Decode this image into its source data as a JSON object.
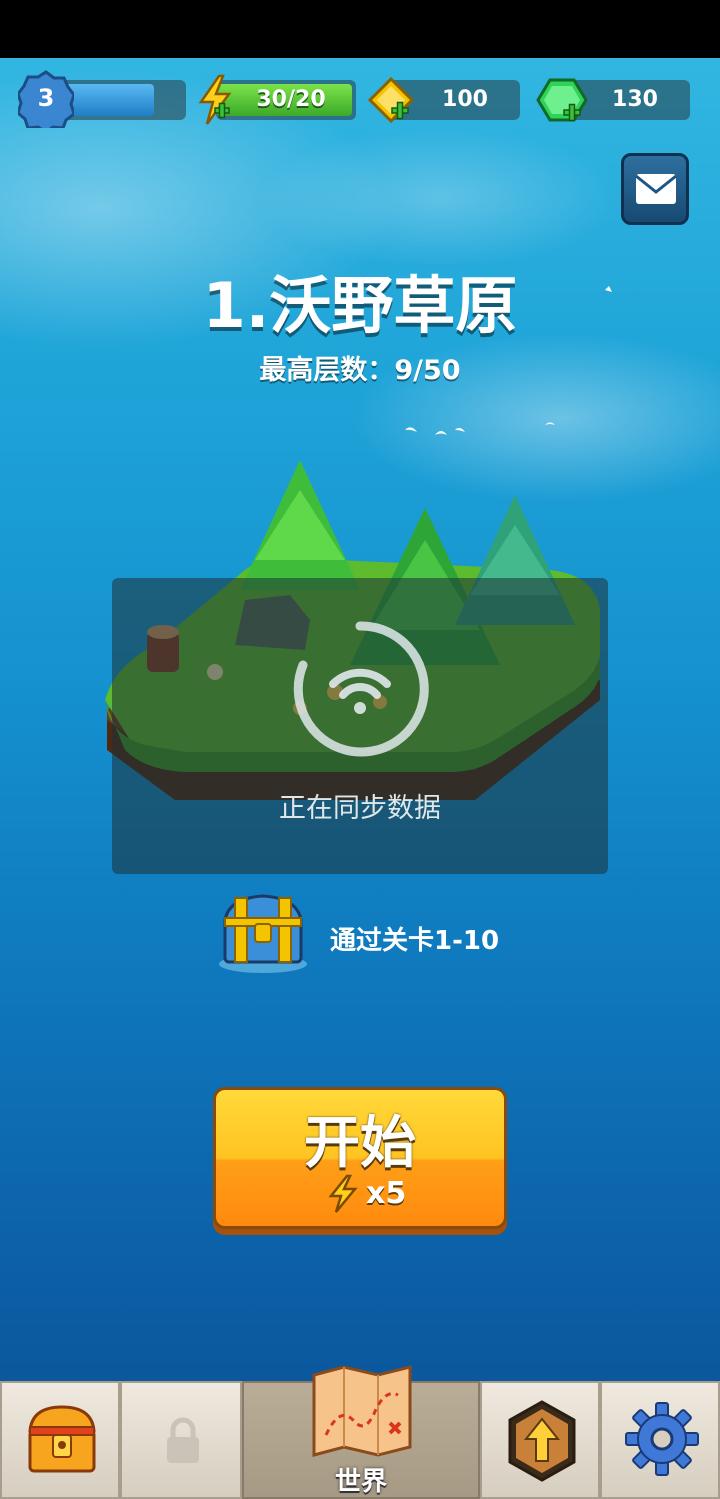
{
  "resources": {
    "level": "3",
    "energy": "30/20",
    "coins": "100",
    "gems": "130"
  },
  "stage": {
    "title": "1.沃野草原",
    "best_floor": "最高层数：9/50"
  },
  "sync": {
    "message": "正在同步数据"
  },
  "reward": {
    "label": "通过关卡1-10"
  },
  "start_button": {
    "label": "开始",
    "cost": "x5"
  },
  "navbar": {
    "items": [
      {
        "id": "chest",
        "icon": "treasure-chest-icon"
      },
      {
        "id": "locked",
        "icon": "lock-icon"
      },
      {
        "id": "world",
        "icon": "map-icon",
        "label": "世界"
      },
      {
        "id": "upgrade",
        "icon": "upgrade-arrow-icon"
      },
      {
        "id": "settings",
        "icon": "gear-icon"
      }
    ]
  },
  "colors": {
    "sky_top": "#35b9e3",
    "sea_bottom": "#0a4f92",
    "button_yellow": "#ffc421",
    "button_orange": "#ff8a0f",
    "energy_green": "#3ca92a",
    "gem_green": "#2fd35a",
    "coin_gold": "#f5c400"
  }
}
